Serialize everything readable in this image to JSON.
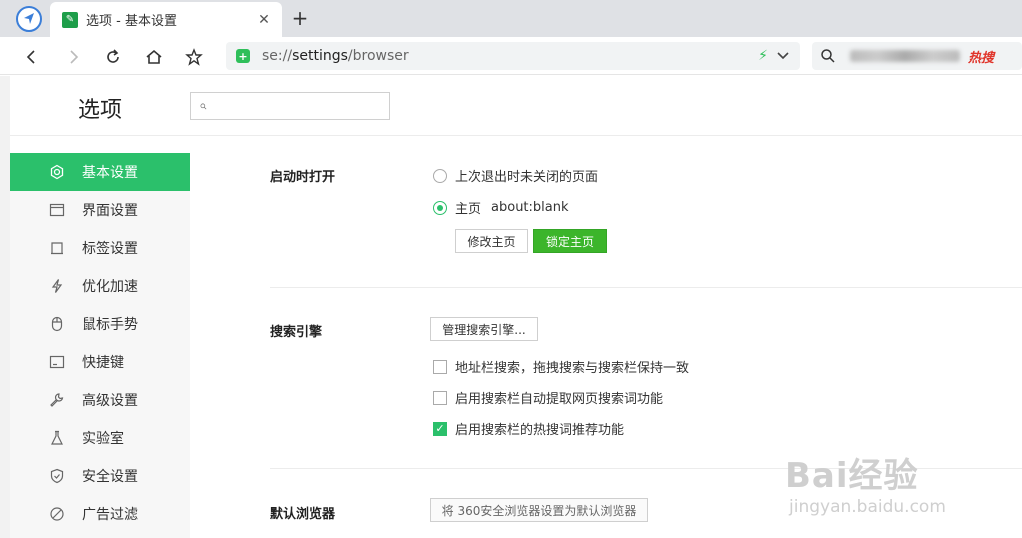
{
  "tab": {
    "title": "选项 - 基本设置",
    "favicon": "wrench-icon"
  },
  "address": {
    "scheme": "se://",
    "host": "settings",
    "path": "/browser"
  },
  "search_bar": {
    "hot_label": "热搜"
  },
  "page": {
    "title": "选项",
    "search_placeholder": ""
  },
  "sidebar": {
    "items": [
      {
        "label": "基本设置",
        "icon": "gear-icon",
        "active": true
      },
      {
        "label": "界面设置",
        "icon": "window-icon",
        "active": false
      },
      {
        "label": "标签设置",
        "icon": "tab-icon",
        "active": false
      },
      {
        "label": "优化加速",
        "icon": "bolt-icon",
        "active": false
      },
      {
        "label": "鼠标手势",
        "icon": "mouse-icon",
        "active": false
      },
      {
        "label": "快捷键",
        "icon": "keyboard-icon",
        "active": false
      },
      {
        "label": "高级设置",
        "icon": "wrench-icon",
        "active": false
      },
      {
        "label": "实验室",
        "icon": "flask-icon",
        "active": false
      },
      {
        "label": "安全设置",
        "icon": "shield-icon",
        "active": false
      },
      {
        "label": "广告过滤",
        "icon": "block-icon",
        "active": false
      }
    ]
  },
  "startup": {
    "label": "启动时打开",
    "option_last": "上次退出时未关闭的页面",
    "option_home": "主页",
    "home_url": "about:blank",
    "edit_home_button": "修改主页",
    "lock_home_button": "锁定主页"
  },
  "search_engine": {
    "label": "搜索引擎",
    "manage_button": "管理搜索引擎...",
    "options": [
      {
        "label": "地址栏搜索，拖拽搜索与搜索栏保持一致",
        "checked": false
      },
      {
        "label": "启用搜索栏自动提取网页搜索词功能",
        "checked": false
      },
      {
        "label": "启用搜索栏的热搜词推荐功能",
        "checked": true
      }
    ]
  },
  "default_browser": {
    "label": "默认浏览器",
    "set_default_button": "将 360安全浏览器设置为默认浏览器"
  },
  "watermark": {
    "main": "Bai经验",
    "sub": "jingyan.baidu.com"
  },
  "colors": {
    "accent": "#2bc06b",
    "lock_button": "#3cb52b",
    "hot": "#e0352b"
  }
}
